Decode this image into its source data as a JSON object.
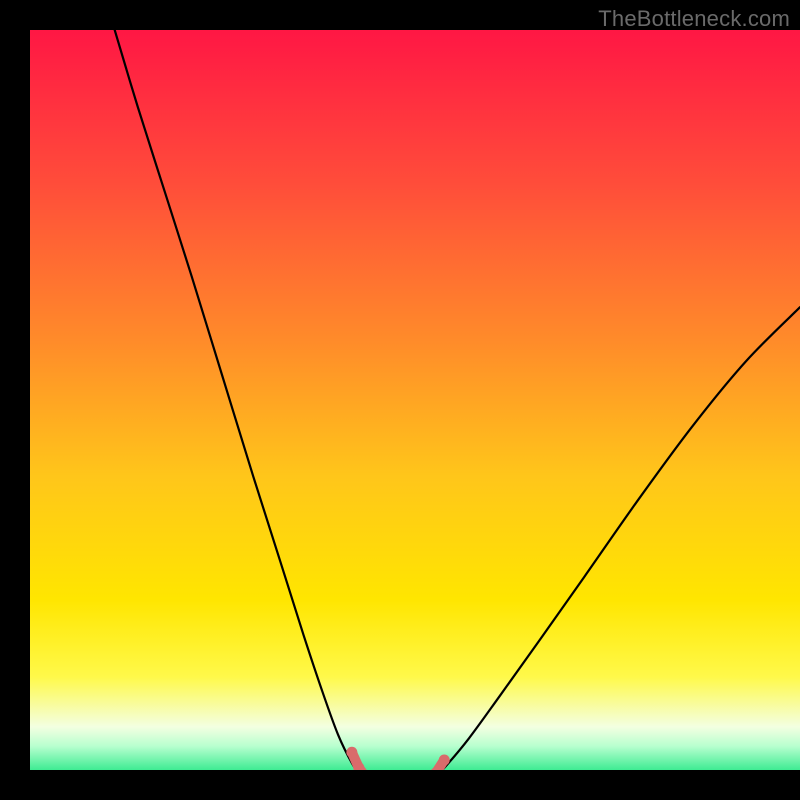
{
  "watermark": "TheBottleneck.com",
  "chart_data": {
    "type": "line",
    "title": "",
    "xlabel": "",
    "ylabel": "",
    "xlim": [
      0,
      100
    ],
    "ylim": [
      0,
      100
    ],
    "grid": false,
    "legend": false,
    "gradient_stops": [
      {
        "offset": 0.0,
        "color": "#ff1744"
      },
      {
        "offset": 0.2,
        "color": "#ff4d3a"
      },
      {
        "offset": 0.4,
        "color": "#ff8a2a"
      },
      {
        "offset": 0.58,
        "color": "#ffc61a"
      },
      {
        "offset": 0.74,
        "color": "#ffe600"
      },
      {
        "offset": 0.84,
        "color": "#fff94a"
      },
      {
        "offset": 0.905,
        "color": "#f3ffe1"
      },
      {
        "offset": 0.93,
        "color": "#b8ffcf"
      },
      {
        "offset": 0.965,
        "color": "#2fe98b"
      },
      {
        "offset": 1.0,
        "color": "#12d977"
      }
    ],
    "series": [
      {
        "name": "bottleneck-curve-left",
        "stroke": "#000000",
        "stroke_width": 2.2,
        "points": [
          {
            "x": 11.0,
            "y": 100.0
          },
          {
            "x": 14.0,
            "y": 90.0
          },
          {
            "x": 17.5,
            "y": 79.0
          },
          {
            "x": 21.0,
            "y": 68.0
          },
          {
            "x": 25.0,
            "y": 55.0
          },
          {
            "x": 29.0,
            "y": 42.0
          },
          {
            "x": 32.5,
            "y": 31.0
          },
          {
            "x": 35.5,
            "y": 21.5
          },
          {
            "x": 38.0,
            "y": 14.0
          },
          {
            "x": 40.0,
            "y": 8.5
          },
          {
            "x": 41.8,
            "y": 4.8
          },
          {
            "x": 43.3,
            "y": 2.6
          }
        ]
      },
      {
        "name": "bottleneck-curve-right",
        "stroke": "#000000",
        "stroke_width": 2.2,
        "points": [
          {
            "x": 52.2,
            "y": 2.6
          },
          {
            "x": 54.0,
            "y": 4.4
          },
          {
            "x": 57.0,
            "y": 8.0
          },
          {
            "x": 61.0,
            "y": 13.5
          },
          {
            "x": 66.0,
            "y": 20.5
          },
          {
            "x": 72.0,
            "y": 29.0
          },
          {
            "x": 79.0,
            "y": 39.0
          },
          {
            "x": 86.0,
            "y": 48.5
          },
          {
            "x": 93.0,
            "y": 57.0
          },
          {
            "x": 100.0,
            "y": 64.0
          }
        ]
      },
      {
        "name": "sweet-spot-dots",
        "stroke": "#d96b6b",
        "stroke_width": 10,
        "linecap": "round",
        "points": [
          {
            "x": 41.8,
            "y": 6.2
          },
          {
            "x": 42.7,
            "y": 4.2
          },
          {
            "x": 43.8,
            "y": 2.7
          },
          {
            "x": 45.0,
            "y": 1.9
          },
          {
            "x": 46.3,
            "y": 1.5
          },
          {
            "x": 47.7,
            "y": 1.5
          },
          {
            "x": 49.1,
            "y": 1.5
          },
          {
            "x": 50.4,
            "y": 1.8
          },
          {
            "x": 51.6,
            "y": 2.4
          },
          {
            "x": 52.7,
            "y": 3.5
          },
          {
            "x": 53.8,
            "y": 5.2
          }
        ]
      }
    ]
  }
}
